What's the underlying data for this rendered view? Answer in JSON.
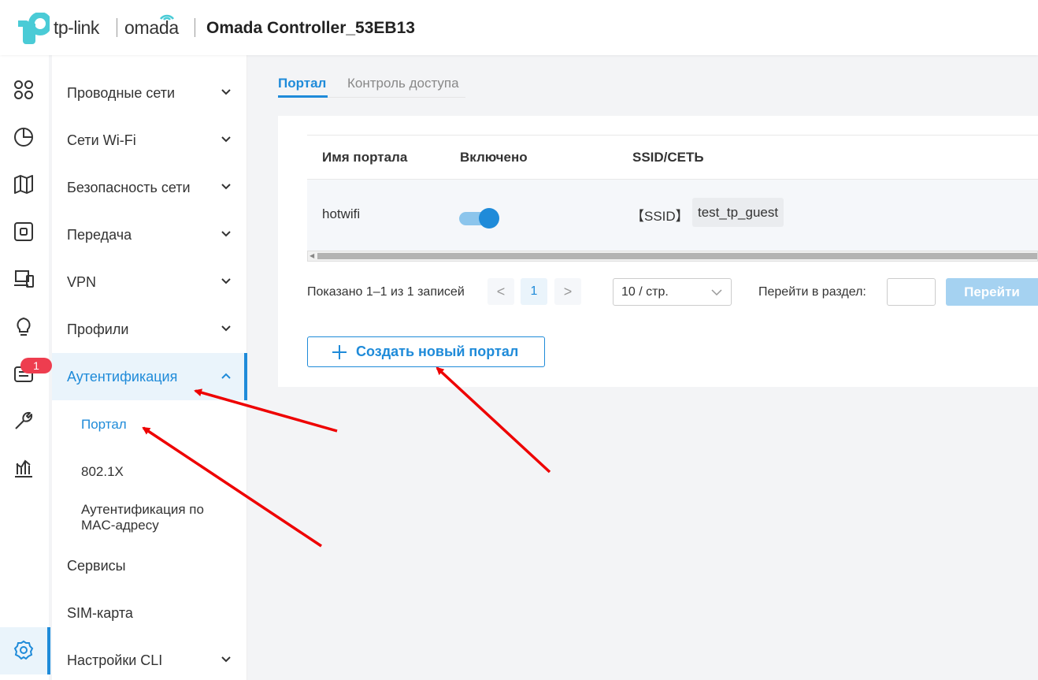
{
  "header": {
    "brand_tp": "tp-link",
    "brand_omada": "omada",
    "controller_name": "Omada Controller_53EB13"
  },
  "rail": {
    "icons": [
      "dashboard-icon",
      "statistics-icon",
      "map-icon",
      "devices-icon",
      "clients-icon",
      "insight-icon",
      "logs-icon",
      "tools-icon",
      "reports-icon",
      "settings-icon"
    ],
    "badge_count": "1"
  },
  "menu": {
    "items": [
      {
        "label": "Проводные сети"
      },
      {
        "label": "Сети Wi-Fi"
      },
      {
        "label": "Безопасность сети"
      },
      {
        "label": "Передача"
      },
      {
        "label": "VPN"
      },
      {
        "label": "Профили"
      },
      {
        "label": "Аутентификация"
      },
      {
        "label": "Сервисы"
      },
      {
        "label": "SIM-карта"
      },
      {
        "label": "Настройки CLI"
      }
    ],
    "sub_items": [
      {
        "label": "Портал"
      },
      {
        "label": "802.1X"
      },
      {
        "label": "Аутентификация по"
      },
      {
        "label": "MAC-адресу"
      }
    ]
  },
  "tabs": [
    {
      "label": "Портал",
      "active": true
    },
    {
      "label": "Контроль доступа",
      "active": false
    }
  ],
  "table": {
    "columns": [
      "Имя портала",
      "Включено",
      "SSID/СЕТЬ"
    ],
    "rows": [
      {
        "name": "hotwifi",
        "enabled": true,
        "ssid_prefix": "【SSID】",
        "ssid": "test_tp_guest"
      }
    ]
  },
  "pagination": {
    "summary": "Показано 1–1 из 1 записей",
    "prev": "<",
    "page": "1",
    "next": ">",
    "page_size": "10 / стр.",
    "goto_label": "Перейти в раздел:",
    "goto_button": "Перейти"
  },
  "actions": {
    "create_portal": "Создать новый портал"
  },
  "colors": {
    "accent": "#1f8bd9",
    "badge": "#ee3d4f",
    "annotation_arrow": "#ee0000"
  }
}
